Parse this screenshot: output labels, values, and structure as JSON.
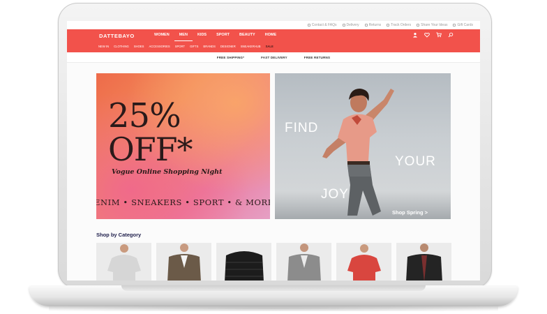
{
  "store": {
    "logo": "DATTEBAYO",
    "utility_links": [
      {
        "label": "Contact & FAQs",
        "icon": "chat-icon"
      },
      {
        "label": "Delivery",
        "icon": "truck-icon"
      },
      {
        "label": "Returns",
        "icon": "return-icon"
      },
      {
        "label": "Track Orders",
        "icon": "tag-icon"
      },
      {
        "label": "Share Your Ideas",
        "icon": "megaphone-icon"
      },
      {
        "label": "Gift Cards",
        "icon": "gift-icon"
      }
    ],
    "main_nav": [
      "WOMEN",
      "MEN",
      "KIDS",
      "SPORT",
      "BEAUTY",
      "HOME"
    ],
    "main_nav_active": "MEN",
    "sub_nav": [
      "NEW IN",
      "CLOTHING",
      "SHOES",
      "ACCESSORIES",
      "SPORT",
      "GIFTS",
      "BRANDS",
      "DESIGNER",
      "SNEAKERHUB",
      "SALE"
    ],
    "nav_icons": [
      "user-icon",
      "heart-icon",
      "cart-icon",
      "search-icon"
    ],
    "promo_strip": [
      "FREE SHIPPING*",
      "FAST DELIVERY",
      "FREE RETURNS"
    ]
  },
  "banners": {
    "sale": {
      "line1": "25%",
      "line2": "OFF*",
      "subtitle": "Vogue Online Shopping Night",
      "ticker": "ENIM • SNEAKERS • SPORT • & MORE • S"
    },
    "joy": {
      "word1": "FIND",
      "word2": "YOUR",
      "word3": "JOY",
      "cta": "Shop Spring >"
    }
  },
  "categories": {
    "title": "Shop by Category",
    "tiles": [
      {
        "item": "grey t-shirt"
      },
      {
        "item": "brown blazer"
      },
      {
        "item": "black puffer jacket"
      },
      {
        "item": "grey blazer"
      },
      {
        "item": "red t-shirt"
      },
      {
        "item": "black jacket"
      }
    ]
  },
  "colors": {
    "brand_red": "#f2524b",
    "category_title": "#1d1d4a"
  }
}
